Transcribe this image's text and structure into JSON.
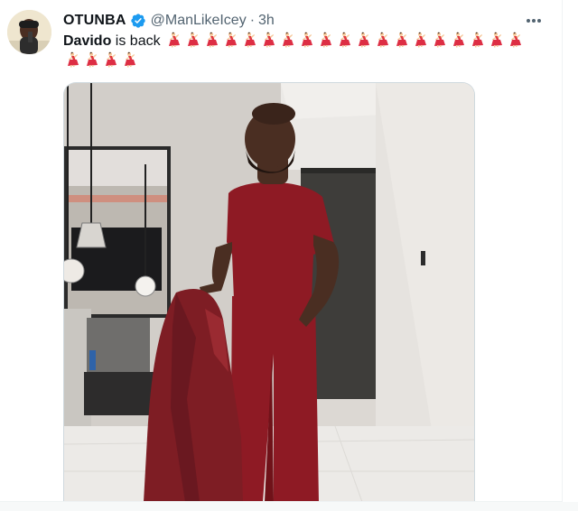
{
  "tweet": {
    "display_name": "OTUNBA",
    "handle": "@ManLikeIcey",
    "separator": "·",
    "time": "3h",
    "mention": "Davido",
    "text_after_mention": " is back",
    "dancer_emoji_count_line1": 19,
    "dancer_emoji_count_line2": 4,
    "emoji_name": "woman-dancing-icon",
    "verified_color": "#1d9bf0",
    "more_icon": "more-horizontal-icon"
  },
  "media": {
    "accent_outfit_color": "#8e1a24"
  }
}
